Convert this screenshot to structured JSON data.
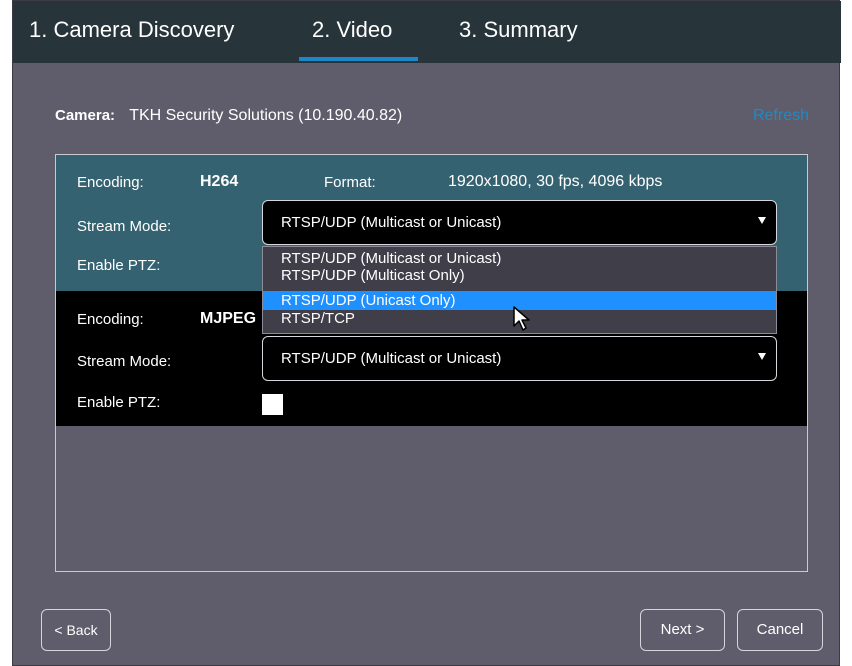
{
  "tabs": [
    {
      "label": "1. Camera Discovery"
    },
    {
      "label": "2. Video"
    },
    {
      "label": "3. Summary"
    }
  ],
  "camera": {
    "label": "Camera:",
    "value": "TKH Security Solutions (10.190.40.82)",
    "refresh_label": "Refresh"
  },
  "streams": [
    {
      "encoding_label": "Encoding:",
      "encoding_value": "H264",
      "format_label": "Format:",
      "format_value": "1920x1080, 30 fps, 4096 kbps",
      "stream_mode_label": "Stream Mode:",
      "stream_mode_value": "RTSP/UDP (Multicast or Unicast)",
      "ptz_label": "Enable PTZ:"
    },
    {
      "encoding_label": "Encoding:",
      "encoding_value": "MJPEG",
      "stream_mode_label": "Stream Mode:",
      "stream_mode_value": "RTSP/UDP (Multicast or Unicast)",
      "ptz_label": "Enable PTZ:"
    }
  ],
  "dropdown_options": [
    {
      "label": "RTSP/UDP (Multicast or Unicast)"
    },
    {
      "label": "RTSP/UDP (Multicast Only)"
    },
    {
      "label": "RTSP/UDP (Unicast Only)"
    },
    {
      "label": "RTSP/TCP"
    }
  ],
  "highlighted_option": "RTSP/UDP (Unicast Only)",
  "footer": {
    "back_label": "< Back",
    "next_label": "Next >",
    "cancel_label": "Cancel"
  },
  "colors": {
    "tab_accent": "#1e87c8",
    "refresh_link": "#1e8ac7",
    "highlight": "#1e90ff",
    "stream1_bg": "#356271"
  }
}
